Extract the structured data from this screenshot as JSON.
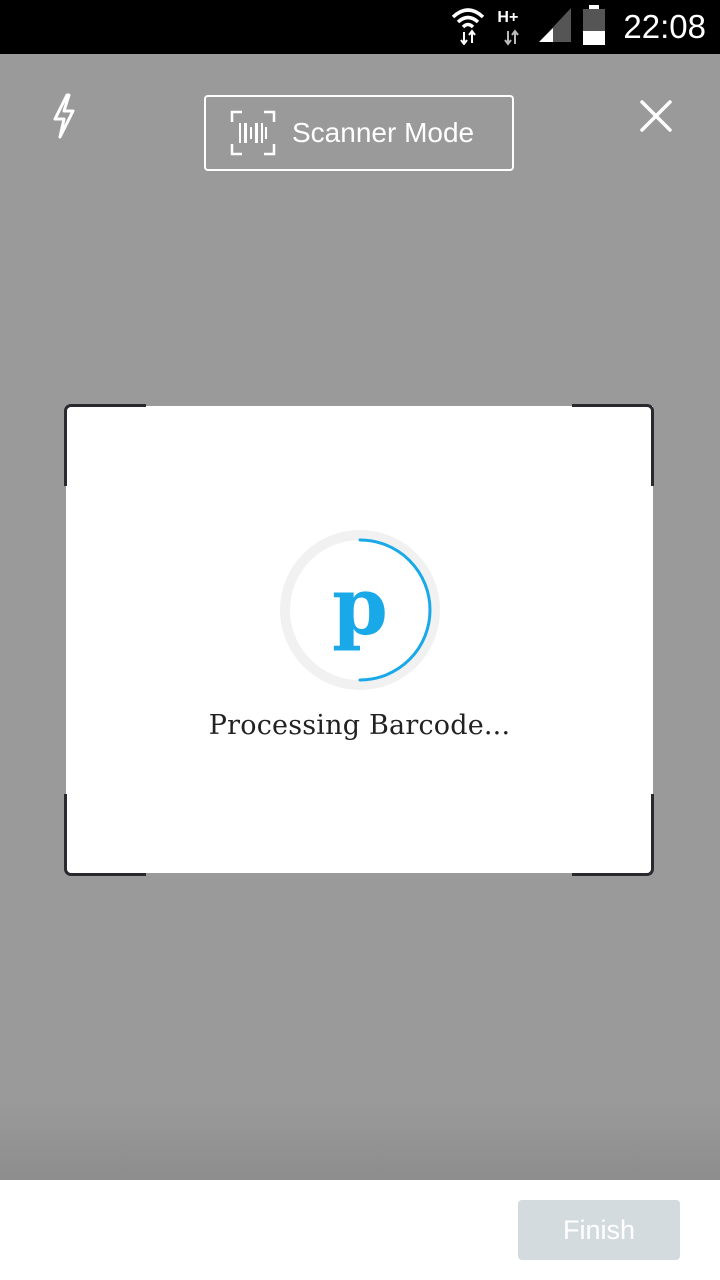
{
  "status_bar": {
    "time": "22:08",
    "network_type": "H+",
    "icons": [
      "wifi-icon",
      "mobile-data-icon",
      "signal-icon",
      "battery-icon"
    ]
  },
  "toolbar": {
    "flash_icon": "flash-icon",
    "mode_icon": "barcode-scan-icon",
    "mode_label": "Scanner Mode",
    "close_icon": "close-icon"
  },
  "scanner": {
    "logo_letter": "p",
    "status_text": "Processing Barcode..."
  },
  "footer": {
    "finish_label": "Finish"
  },
  "colors": {
    "camera_overlay": "#9b9b9b",
    "accent_blue": "#1aa9e8",
    "finish_disabled": "#d3dbdf"
  }
}
